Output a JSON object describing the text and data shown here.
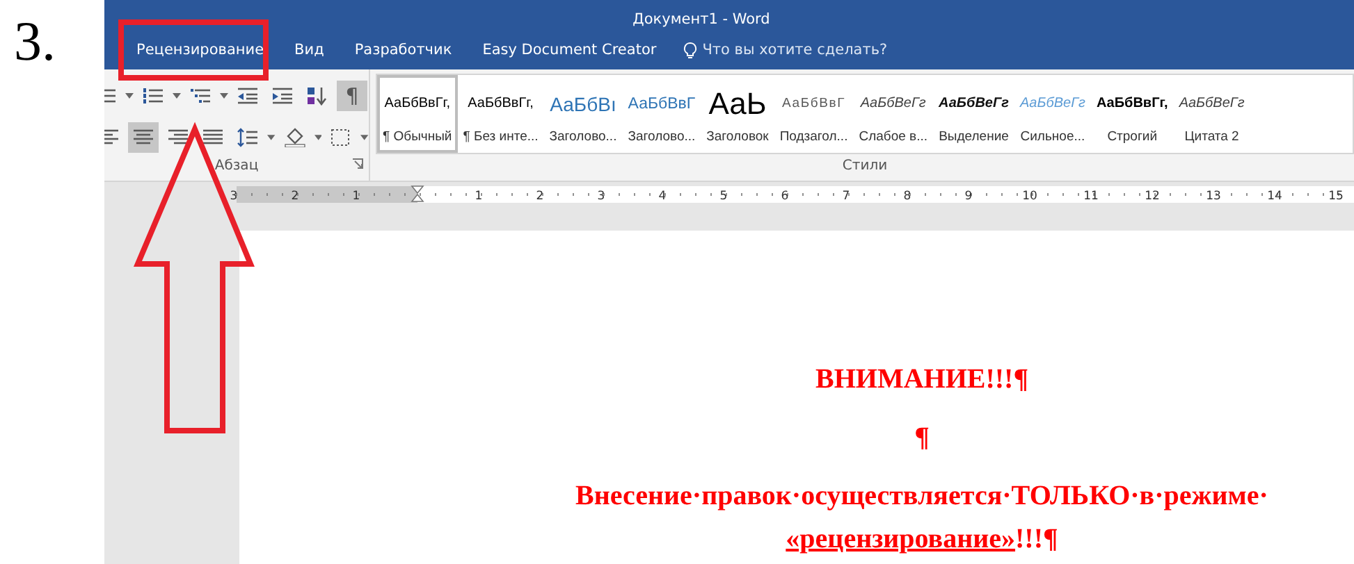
{
  "step_number": "3.",
  "window": {
    "title": "Документ1 - Word"
  },
  "tabs": [
    {
      "label": "Рецензирование",
      "selected": false
    },
    {
      "label": "Вид",
      "selected": false
    },
    {
      "label": "Разработчик",
      "selected": false
    },
    {
      "label": "Easy Document Creator",
      "selected": false
    }
  ],
  "tell_me": {
    "placeholder": "Что вы хотите сделать?"
  },
  "paragraph_group": {
    "label": "Абзац",
    "row_1": [
      {
        "kind": "bullets",
        "selected": false
      },
      {
        "kind": "numbering",
        "selected": false
      },
      {
        "kind": "multilevel",
        "selected": false
      },
      {
        "kind": "outdent",
        "selected": false
      },
      {
        "kind": "indent",
        "selected": false
      },
      {
        "kind": "sort",
        "selected": false
      },
      {
        "kind": "pilcrow",
        "label": "¶",
        "selected": true
      }
    ],
    "row_2": [
      {
        "kind": "align-left",
        "selected": false
      },
      {
        "kind": "align-center",
        "selected": true
      },
      {
        "kind": "align-right",
        "selected": false
      },
      {
        "kind": "justify",
        "selected": false
      },
      {
        "kind": "line-spacing",
        "selected": false
      },
      {
        "kind": "shading",
        "selected": false
      },
      {
        "kind": "borders",
        "selected": false
      }
    ]
  },
  "styles_group": {
    "label": "Стили",
    "items": [
      {
        "preview": "АаБбВвГг,",
        "name": "¶ Обычный",
        "kind": "normal",
        "selected": true
      },
      {
        "preview": "АаБбВвГг,",
        "name": "¶ Без инте...",
        "kind": "normal",
        "selected": false
      },
      {
        "preview": "АаБбВı",
        "name": "Заголово...",
        "kind": "heading1",
        "selected": false
      },
      {
        "preview": "АаБбВвГ",
        "name": "Заголово...",
        "kind": "heading2",
        "selected": false
      },
      {
        "preview": "АаЬ",
        "name": "Заголовок",
        "kind": "title",
        "selected": false
      },
      {
        "preview": "АаБбВвГ",
        "name": "Подзагол...",
        "kind": "subtitle",
        "selected": false
      },
      {
        "preview": "АаБбВеГг",
        "name": "Слабое в...",
        "kind": "subtle",
        "selected": false
      },
      {
        "preview": "АаБбВеГг",
        "name": "Выделение",
        "kind": "emphasis",
        "selected": false
      },
      {
        "preview": "АаБбВеГг",
        "name": "Сильное...",
        "kind": "intense",
        "selected": false
      },
      {
        "preview": "АаБбВвГг,",
        "name": "Строгий",
        "kind": "strong",
        "selected": false
      },
      {
        "preview": "АаБбВеГг",
        "name": "Цитата 2",
        "kind": "quote",
        "selected": false
      }
    ]
  },
  "ruler": {
    "left_numbers": [
      "3",
      "2",
      "1"
    ],
    "numbers": [
      "1",
      "2",
      "3",
      "4",
      "5",
      "6",
      "7",
      "8",
      "9",
      "10",
      "11",
      "12",
      "13",
      "14",
      "15"
    ]
  },
  "document": {
    "paragraphs": [
      {
        "lines": [
          [
            {
              "text": "ВНИМАНИЕ!!!¶",
              "underline": false
            }
          ]
        ]
      },
      {
        "lines": [
          [
            {
              "text": "¶",
              "underline": false
            }
          ]
        ]
      },
      {
        "lines": [
          [
            {
              "text": "Внесение·правок·осуществляется·ТОЛЬКО·в·режиме·",
              "underline": false
            }
          ],
          [
            {
              "text": "«рецензирование»",
              "underline": true
            },
            {
              "text": "!!!¶",
              "underline": false
            }
          ]
        ]
      }
    ]
  }
}
